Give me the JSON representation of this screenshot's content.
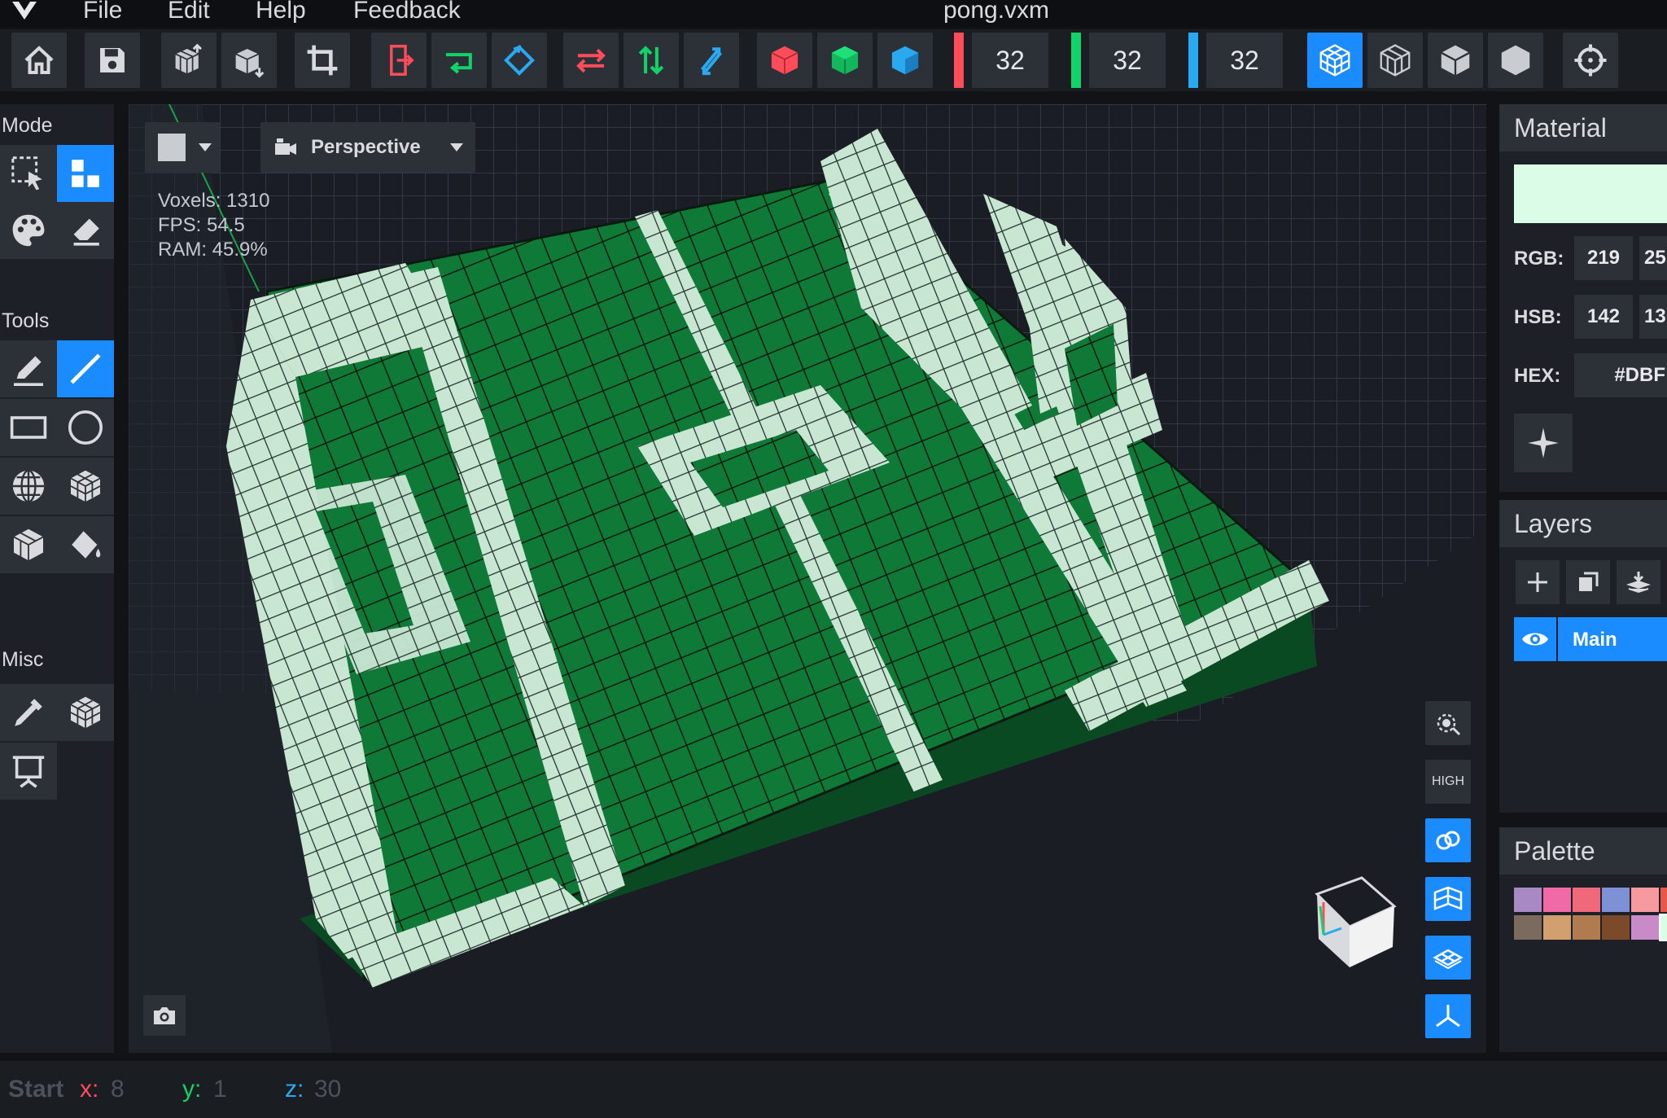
{
  "menubar": {
    "items": [
      "File",
      "Edit",
      "Help",
      "Feedback"
    ],
    "document_title": "pong.vxm"
  },
  "toolbar": {
    "buttons": [
      {
        "icon": "home-icon"
      },
      {
        "icon": "save-icon"
      },
      {
        "icon": "import-voxels-icon"
      },
      {
        "icon": "export-voxels-icon"
      },
      {
        "icon": "crop-icon"
      },
      {
        "icon": "mirror-x-icon"
      },
      {
        "icon": "mirror-y-icon"
      },
      {
        "icon": "mirror-z-icon"
      },
      {
        "icon": "flip-x-icon"
      },
      {
        "icon": "flip-y-icon"
      },
      {
        "icon": "flip-z-icon"
      },
      {
        "icon": "rotate-x-icon"
      },
      {
        "icon": "rotate-y-icon"
      },
      {
        "icon": "rotate-z-icon"
      }
    ],
    "dimensions": {
      "x": "32",
      "y": "32",
      "z": "32"
    },
    "dim_colors": {
      "x": "#ff4c5a",
      "y": "#12d26a",
      "z": "#2aa8f0"
    },
    "render_modes": [
      "wireframe-cube-icon",
      "outline-cube-icon",
      "shaded-cube-icon",
      "solid-hexagon-icon"
    ],
    "target_icon": "crosshair-icon"
  },
  "left_panel": {
    "mode_label": "Mode",
    "tools_label": "Tools",
    "misc_label": "Misc"
  },
  "viewport": {
    "view_mode": "Perspective",
    "stats": {
      "voxels": "Voxels: 1310",
      "fps": "FPS: 54.5",
      "ram": "RAM: 45.9%"
    },
    "quality_label": "HIGH"
  },
  "material": {
    "title": "Material",
    "preview_color": "#dbfce7",
    "rgb_label": "RGB:",
    "rgb": [
      "219",
      "25"
    ],
    "hsb_label": "HSB:",
    "hsb": [
      "142",
      "13"
    ],
    "hex_label": "HEX:",
    "hex": "#DBF"
  },
  "layers": {
    "title": "Layers",
    "items": [
      {
        "name": "Main",
        "visible": true
      }
    ]
  },
  "palette": {
    "title": "Palette",
    "colors_row1": [
      "#a889c4",
      "#f06aa8",
      "#f0697a",
      "#7e91d6",
      "#f79aa0",
      "#e8584a"
    ],
    "colors_row2": [
      "#7b6a5e",
      "#d1a06e",
      "#b07b4e",
      "#7a4a2a",
      "#c98ac8",
      "#dbfce7"
    ]
  },
  "status": {
    "start_label": "Start",
    "x_label": "x:",
    "x": "8",
    "y_label": "y:",
    "y": "1",
    "z_label": "z:",
    "z": "30"
  },
  "colors": {
    "accent": "#1a8cff",
    "voxel_green": "#0f7a37",
    "voxel_light": "#c9e6d3"
  }
}
